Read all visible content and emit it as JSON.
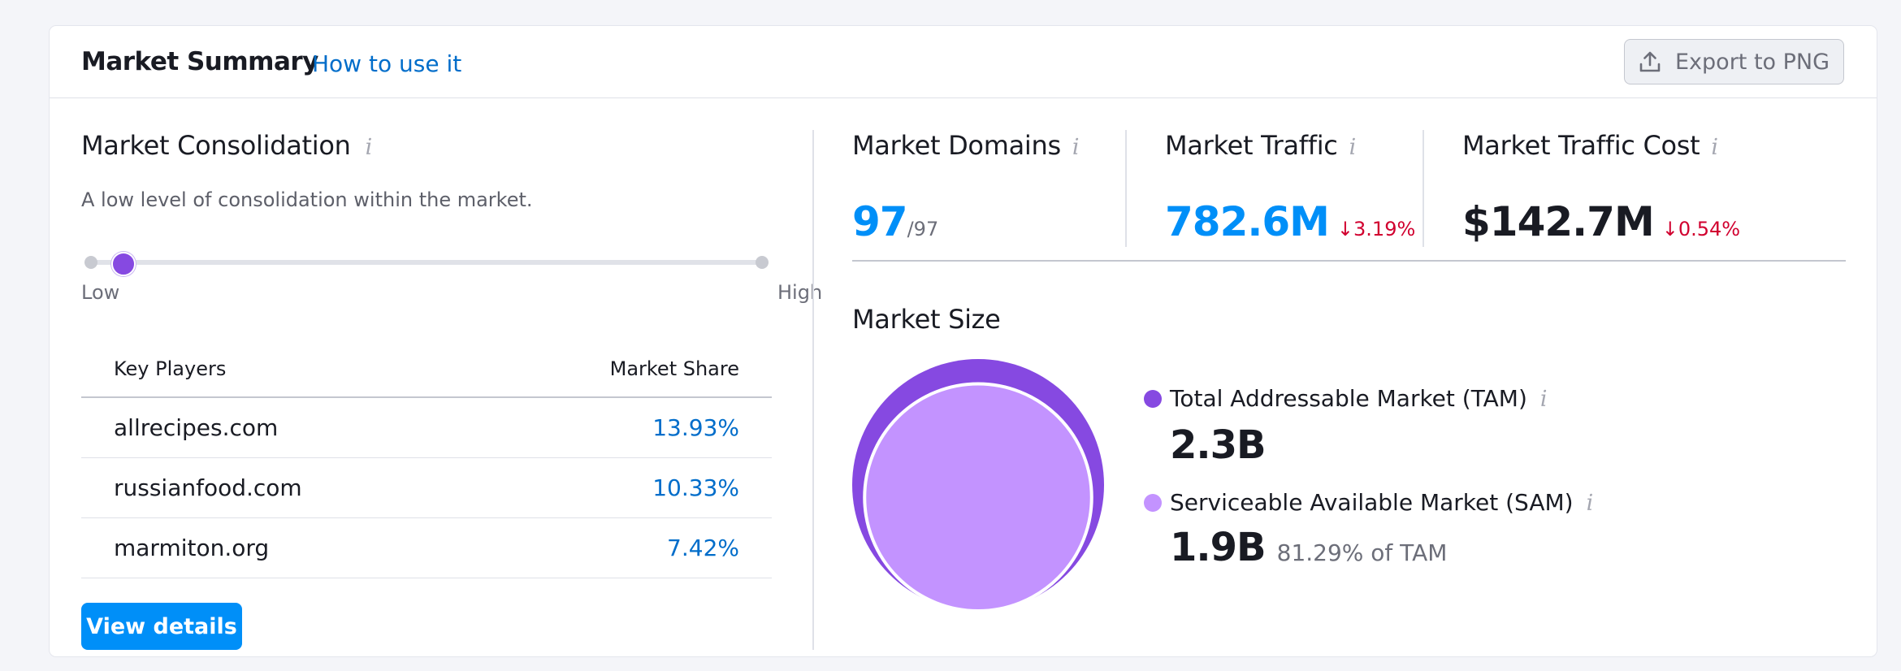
{
  "header": {
    "title": "Market Summary",
    "help_link": "How to use it",
    "export_label": "Export to PNG"
  },
  "consolidation": {
    "title": "Market Consolidation",
    "description": "A low level of consolidation within the market.",
    "level": 0.05,
    "low_label": "Low",
    "high_label": "High"
  },
  "key_players": {
    "col_player": "Key Players",
    "col_share": "Market Share",
    "rows": [
      {
        "domain": "allrecipes.com",
        "share": "13.93%"
      },
      {
        "domain": "russianfood.com",
        "share": "10.33%"
      },
      {
        "domain": "marmiton.org",
        "share": "7.42%"
      }
    ]
  },
  "view_details_label": "View details",
  "metrics": {
    "domains": {
      "label": "Market Domains",
      "value": "97",
      "total": "/97"
    },
    "traffic": {
      "label": "Market Traffic",
      "value": "782.6M",
      "delta": "3.19%"
    },
    "traffic_cost": {
      "label": "Market Traffic Cost",
      "value": "$142.7M",
      "delta": "0.54%"
    }
  },
  "market_size": {
    "title": "Market Size",
    "tam": {
      "label": "Total Addressable Market (TAM)",
      "value": "2.3B",
      "color": "#8649e1"
    },
    "sam": {
      "label": "Serviceable Available Market (SAM)",
      "value": "1.9B",
      "sub": "81.29% of TAM",
      "color": "#c393ff",
      "ratio_of_tam": 0.8129
    }
  },
  "colors": {
    "accent_blue": "#008ff8",
    "link_blue": "#006dca",
    "negative_red": "#d1002f",
    "thumb_purple": "#8649e1"
  },
  "icons": {
    "info": "info-icon",
    "export": "upload-icon",
    "down_arrow": "arrow-down-icon"
  }
}
